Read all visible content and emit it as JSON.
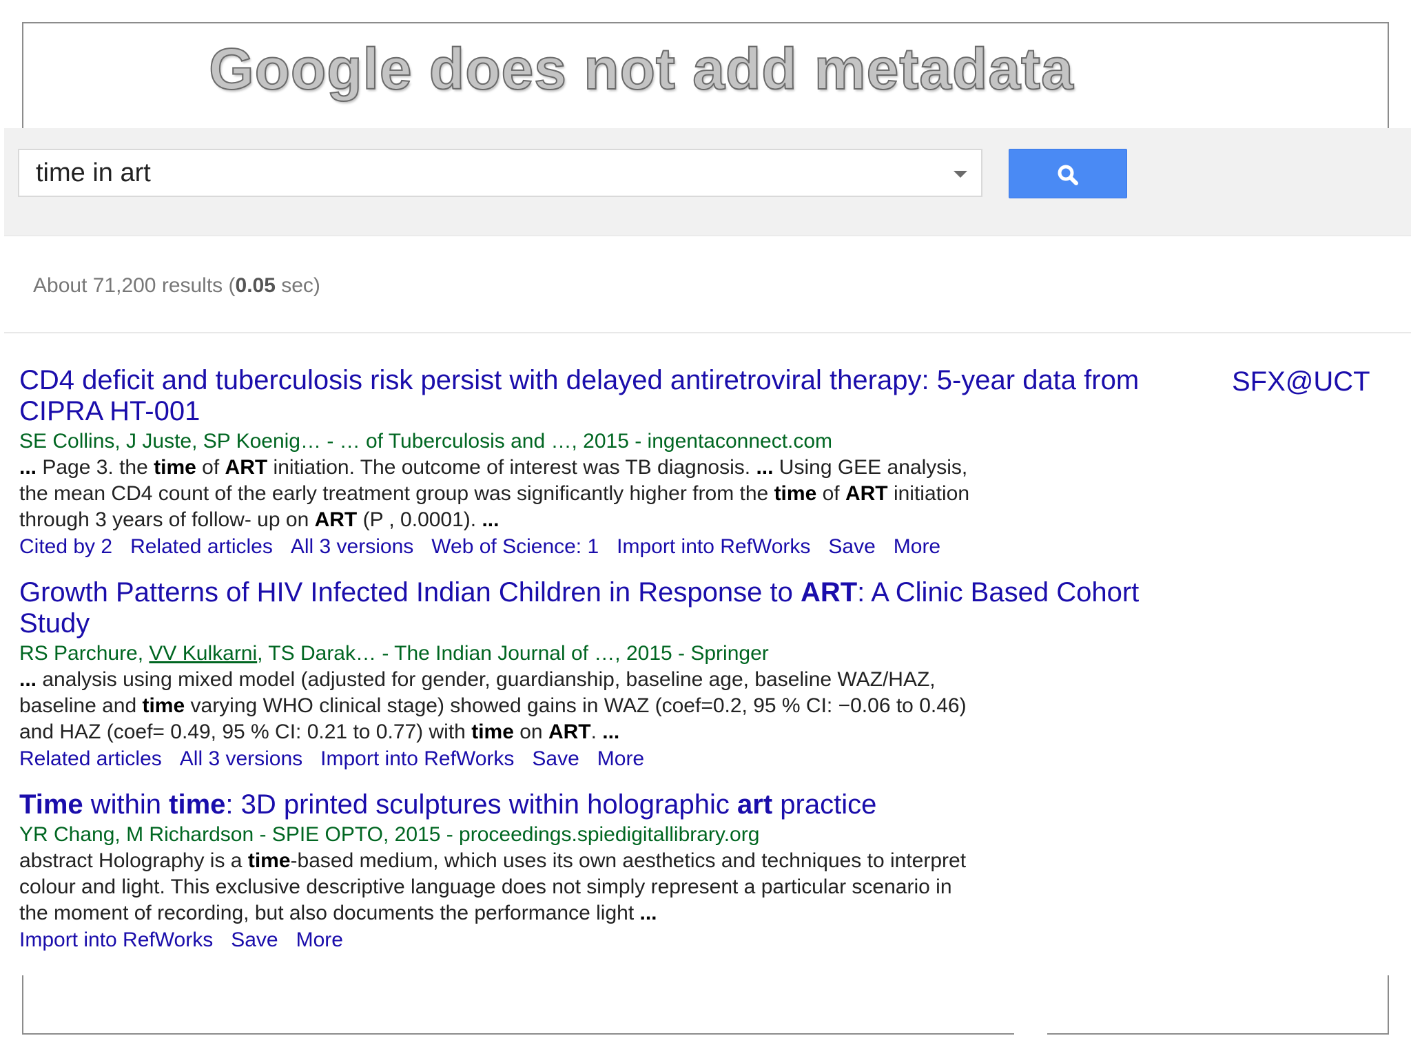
{
  "slide": {
    "title": "Google does not add metadata"
  },
  "search": {
    "query": "time in art"
  },
  "results_stats": {
    "prefix": "About 71,200 results (",
    "time": "0.05",
    "suffix": " sec)"
  },
  "sfx_link": "SFX@UCT",
  "results": [
    {
      "title": [
        {
          "t": "CD4 deficit and tuberculosis risk persist with delayed antiretroviral therapy: 5-year data from CIPRA HT-001",
          "b": false
        }
      ],
      "meta": [
        {
          "t": "SE Collins, J Juste, SP Koenig… - … of Tuberculosis and …, 2015 - ingentaconnect.com",
          "u": false
        }
      ],
      "snippet": [
        {
          "t": "... ",
          "b": true
        },
        {
          "t": "Page 3. the ",
          "b": false
        },
        {
          "t": "time",
          "b": true
        },
        {
          "t": " of ",
          "b": false
        },
        {
          "t": "ART",
          "b": true
        },
        {
          "t": " initiation. The outcome of interest was TB diagnosis. ",
          "b": false
        },
        {
          "t": "...",
          "b": true
        },
        {
          "t": " Using GEE analysis, the mean CD4 count of the early treatment group was significantly higher from the ",
          "b": false
        },
        {
          "t": "time",
          "b": true
        },
        {
          "t": " of ",
          "b": false
        },
        {
          "t": "ART",
          "b": true
        },
        {
          "t": " initiation through 3 years of follow- up on ",
          "b": false
        },
        {
          "t": "ART",
          "b": true
        },
        {
          "t": " (P , 0.0001). ",
          "b": false
        },
        {
          "t": "...",
          "b": true
        }
      ],
      "links": [
        "Cited by 2",
        "Related articles",
        "All 3 versions",
        "Web of Science: 1",
        "Import into RefWorks",
        "Save",
        "More"
      ]
    },
    {
      "title": [
        {
          "t": "Growth Patterns of HIV Infected Indian Children in Response to ",
          "b": false
        },
        {
          "t": "ART",
          "b": true
        },
        {
          "t": ": A Clinic Based Cohort Study",
          "b": false
        }
      ],
      "meta": [
        {
          "t": "RS Parchure, ",
          "u": false
        },
        {
          "t": "VV Kulkarni",
          "u": true
        },
        {
          "t": ", TS Darak… - The Indian Journal of …, 2015 - Springer",
          "u": false
        }
      ],
      "snippet": [
        {
          "t": "...",
          "b": true
        },
        {
          "t": " analysis using mixed model (adjusted for gender, guardianship, baseline age, baseline WAZ/HAZ, baseline and ",
          "b": false
        },
        {
          "t": "time",
          "b": true
        },
        {
          "t": " varying WHO clinical stage) showed gains in WAZ (coef=0.2, 95 % CI: −0.06 to 0.46) and HAZ (coef= 0.49, 95 % CI: 0.21 to 0.77) with ",
          "b": false
        },
        {
          "t": "time",
          "b": true
        },
        {
          "t": " on ",
          "b": false
        },
        {
          "t": "ART",
          "b": true
        },
        {
          "t": ". ",
          "b": false
        },
        {
          "t": "...",
          "b": true
        }
      ],
      "links": [
        "Related articles",
        "All 3 versions",
        "Import into RefWorks",
        "Save",
        "More"
      ]
    },
    {
      "title": [
        {
          "t": "Time",
          "b": true
        },
        {
          "t": " within ",
          "b": false
        },
        {
          "t": "time",
          "b": true
        },
        {
          "t": ": 3D printed sculptures within holographic ",
          "b": false
        },
        {
          "t": "art",
          "b": true
        },
        {
          "t": " practice",
          "b": false
        }
      ],
      "meta": [
        {
          "t": "YR Chang, M Richardson - SPIE OPTO, 2015 - proceedings.spiedigitallibrary.org",
          "u": false
        }
      ],
      "snippet": [
        {
          "t": "abstract Holography is a ",
          "b": false
        },
        {
          "t": "time",
          "b": true
        },
        {
          "t": "-based medium, which uses its own aesthetics and techniques to interpret colour and light. This exclusive descriptive language does not simply represent a particular scenario in the moment of recording, but also documents the performance light ",
          "b": false
        },
        {
          "t": "...",
          "b": true
        }
      ],
      "links": [
        "Import into RefWorks",
        "Save",
        "More"
      ]
    }
  ]
}
